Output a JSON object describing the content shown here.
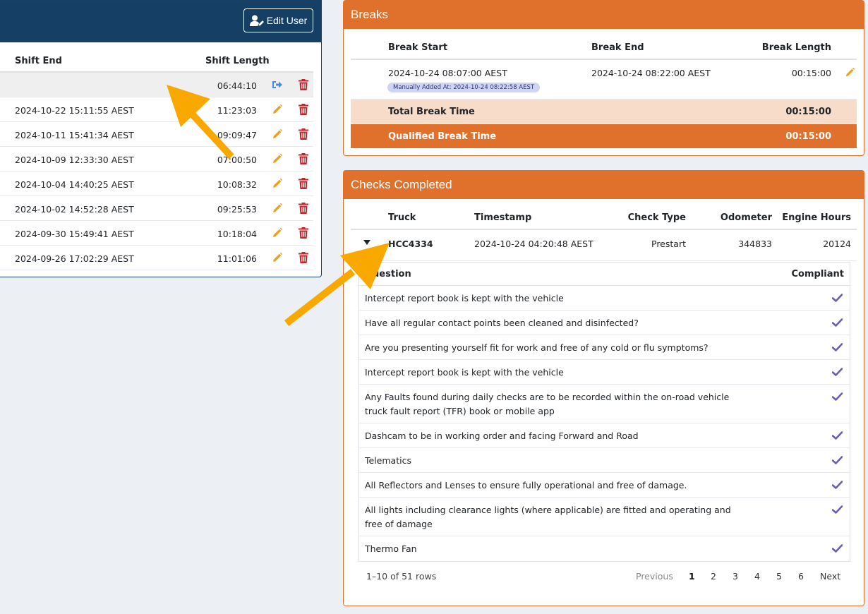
{
  "shifts": {
    "edit_user_label": "Edit User",
    "columns": {
      "shift_end": "Shift End",
      "shift_length": "Shift Length"
    },
    "rows": [
      {
        "end": "",
        "length": "06:44:10",
        "action": "clock-out"
      },
      {
        "end": "2024-10-22 15:11:55 AEST",
        "length": "11:23:03",
        "action": "edit"
      },
      {
        "end": "2024-10-11 15:41:34 AEST",
        "length": "09:09:47",
        "action": "edit"
      },
      {
        "end": "2024-10-09 12:33:30 AEST",
        "length": "07:00:50",
        "action": "edit"
      },
      {
        "end": "2024-10-04 14:40:25 AEST",
        "length": "10:08:32",
        "action": "edit"
      },
      {
        "end": "2024-10-02 14:52:28 AEST",
        "length": "09:25:53",
        "action": "edit"
      },
      {
        "end": "2024-09-30 15:49:41 AEST",
        "length": "10:18:04",
        "action": "edit"
      },
      {
        "end": "2024-09-26 17:02:29 AEST",
        "length": "11:01:06",
        "action": "edit"
      }
    ]
  },
  "breaks": {
    "title": "Breaks",
    "columns": {
      "start": "Break Start",
      "end": "Break End",
      "length": "Break Length"
    },
    "row": {
      "start": "2024-10-24 08:07:00 AEST",
      "end": "2024-10-24 08:22:00 AEST",
      "length": "00:15:00",
      "badge": "Manually Added At: 2024-10-24 08:22:58 AEST"
    },
    "total_label": "Total Break Time",
    "total_value": "00:15:00",
    "qualified_label": "Qualified Break Time",
    "qualified_value": "00:15:00"
  },
  "checks": {
    "title": "Checks Completed",
    "columns": {
      "truck": "Truck",
      "timestamp": "Timestamp",
      "check_type": "Check Type",
      "odometer": "Odometer",
      "engine_hours": "Engine Hours"
    },
    "row": {
      "truck": "HCC4334",
      "timestamp": "2024-10-24 04:20:48 AEST",
      "check_type": "Prestart",
      "odometer": "344833",
      "engine_hours": "20124"
    },
    "question_header": "Question",
    "compliant_header": "Compliant",
    "questions": [
      "Intercept report book is kept with the vehicle",
      "Have all regular contact points been cleaned and disinfected?",
      "Are you presenting yourself fit for work and free of any cold or flu symptoms?",
      "Intercept report book is kept with the vehicle",
      "Any Faults found during daily checks are to be recorded within the on-road vehicle truck fault report (TFR) book or mobile app",
      "Dashcam to be in working order and facing Forward and Road",
      "Telematics",
      "All Reflectors and Lenses to ensure fully operational and free of damage.",
      "All lights including clearance lights (where applicable) are fitted and operating and free of damage",
      "Thermo Fan"
    ],
    "pagination": {
      "info": "1–10 of 51 rows",
      "previous": "Previous",
      "pages": [
        "1",
        "2",
        "3",
        "4",
        "5",
        "6"
      ],
      "next": "Next"
    }
  },
  "colors": {
    "navy": "#163f66",
    "orange": "#e0712c",
    "check": "#6f5bb5",
    "pencil": "#f0a020",
    "trash": "#c0282d",
    "arrow": "#f9a800"
  }
}
